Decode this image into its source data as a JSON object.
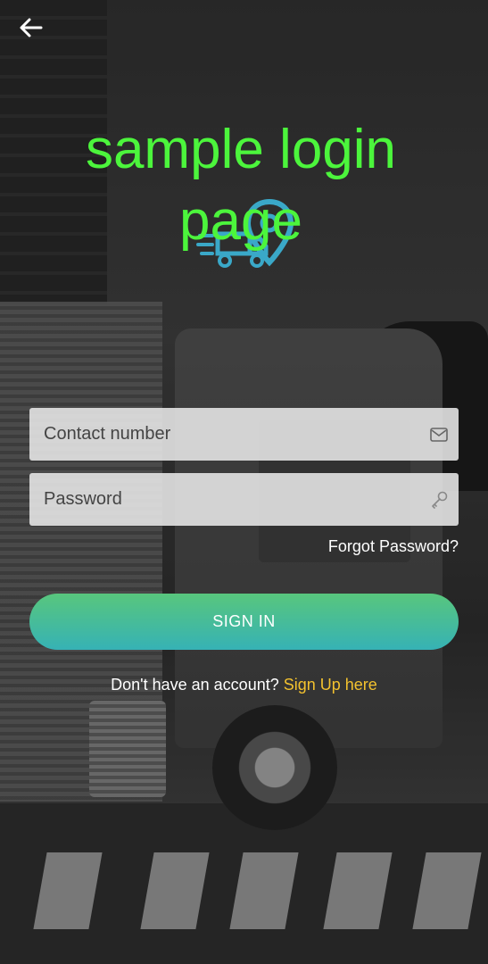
{
  "header": {
    "back_icon": "arrow-left-icon",
    "title": "sample login page"
  },
  "logo": {
    "icon": "delivery-truck-location-logo",
    "colors": [
      "#3aa8c8",
      "#4cf53c"
    ]
  },
  "form": {
    "contact_placeholder": "Contact number",
    "contact_icon": "envelope-icon",
    "password_placeholder": "Password",
    "password_icon": "key-icon",
    "forgot_password": "Forgot Password?",
    "sign_in_label": "SIGN IN"
  },
  "footer": {
    "prompt": "Don't have an account?",
    "signup_link": "Sign Up here"
  },
  "colors": {
    "title": "#4cf53c",
    "button_gradient_top": "#58c67d",
    "button_gradient_bottom": "#36b2b5",
    "signup_link": "#f2c12e"
  }
}
